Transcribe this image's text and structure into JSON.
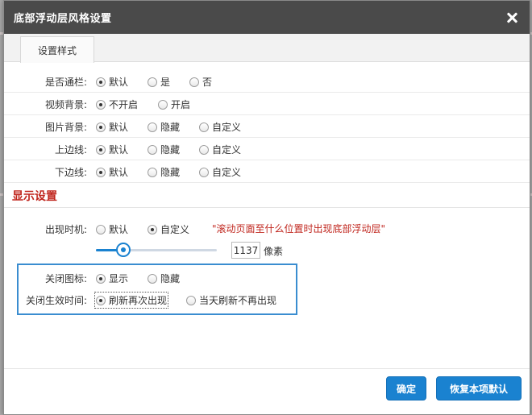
{
  "dialog": {
    "title": "底部浮动层风格设置"
  },
  "tabs": [
    {
      "label": "设置样式"
    }
  ],
  "rows": {
    "tonglan": {
      "label": "是否通栏:",
      "options": [
        "默认",
        "是",
        "否"
      ],
      "selected": 0
    },
    "video_bg": {
      "label": "视频背景:",
      "options": [
        "不开启",
        "开启"
      ],
      "selected": 0
    },
    "image_bg": {
      "label": "图片背景:",
      "options": [
        "默认",
        "隐藏",
        "自定义"
      ],
      "selected": 0
    },
    "top_border": {
      "label": "上边线:",
      "options": [
        "默认",
        "隐藏",
        "自定义"
      ],
      "selected": 0
    },
    "bottom_border": {
      "label": "下边线:",
      "options": [
        "默认",
        "隐藏",
        "自定义"
      ],
      "selected": 0
    }
  },
  "display_section": {
    "heading": "显示设置",
    "appear_time": {
      "label": "出现时机:",
      "options": [
        "默认",
        "自定义"
      ],
      "selected": 1,
      "hint": "\"滚动页面至什么位置时出现底部浮动层\"",
      "value": "1137",
      "unit": "像素"
    },
    "close_icon": {
      "label": "关闭图标:",
      "options": [
        "显示",
        "隐藏"
      ],
      "selected": 0
    },
    "close_effect": {
      "label": "关闭生效时间:",
      "options": [
        "刷新再次出现",
        "当天刷新不再出现"
      ],
      "selected": 0
    }
  },
  "footer": {
    "confirm_label": "确定",
    "reset_label": "恢复本项默认"
  },
  "colors": {
    "accent": "#1a82d0",
    "warning_text": "#c0261e",
    "titlebar": "#4a4a4a"
  }
}
